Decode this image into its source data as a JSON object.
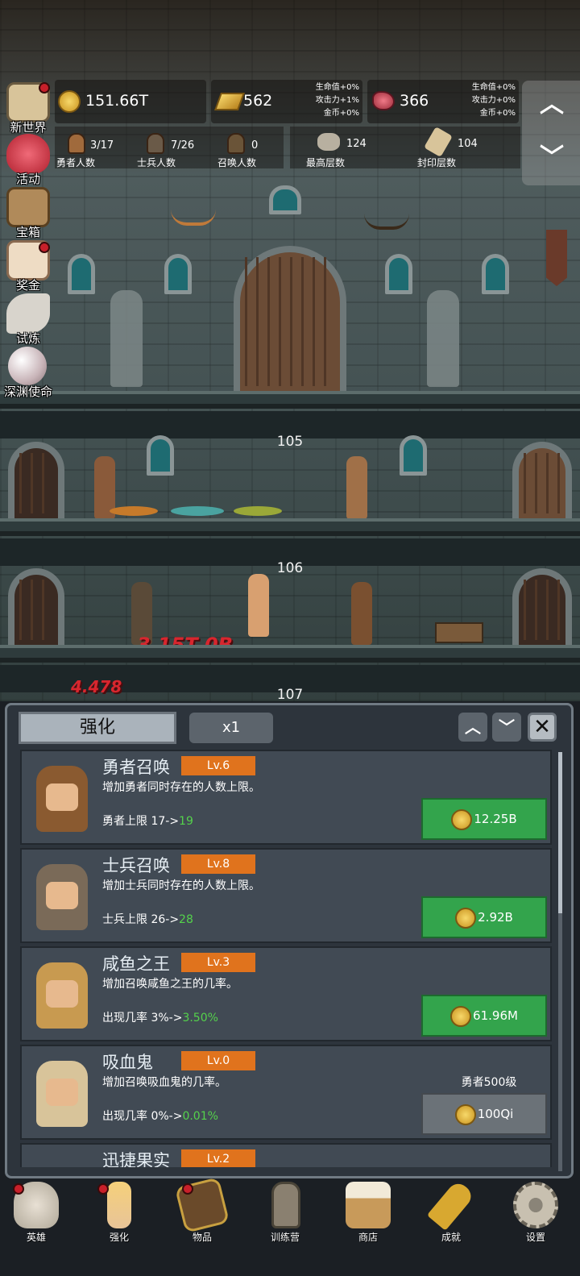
{
  "resources": {
    "coins": "151.66T",
    "gold": "562",
    "gold_bonus": [
      "生命值+0%",
      "攻击力+1%",
      "金币+0%"
    ],
    "gems": "366",
    "gems_bonus": [
      "生命值+0%",
      "攻击力+0%",
      "金币+0%"
    ]
  },
  "stats": [
    {
      "value": "3/17",
      "label": "勇者人数"
    },
    {
      "value": "7/26",
      "label": "士兵人数"
    },
    {
      "value": "0",
      "label": "召唤人数"
    },
    {
      "value": "124",
      "label": "最高层数"
    },
    {
      "value": "104",
      "label": "封印层数"
    }
  ],
  "side_menu": [
    {
      "label": "新世界",
      "icon": "map-icon",
      "dot": true
    },
    {
      "label": "活动",
      "icon": "heart-icon",
      "dot": false
    },
    {
      "label": "宝箱",
      "icon": "chest-icon",
      "dot": false
    },
    {
      "label": "奖金",
      "icon": "envelope-icon",
      "dot": true
    },
    {
      "label": "试炼",
      "icon": "feather-icon",
      "dot": false
    },
    {
      "label": "深渊使命",
      "icon": "pearl-icon",
      "dot": false
    }
  ],
  "scene": {
    "floors": [
      "105",
      "106",
      "107"
    ],
    "damage_1": "3.15T 0B",
    "damage_2": "4.478"
  },
  "panel": {
    "tab_label": "强化",
    "multiplier": "x1",
    "cards": [
      {
        "name": "勇者召唤",
        "level": "Lv.6",
        "desc": "增加勇者同时存在的人数上限。",
        "effect_prefix": "勇者上限 17->",
        "effect_new": "19",
        "cost": "12.25B",
        "locked": false
      },
      {
        "name": "士兵召唤",
        "level": "Lv.8",
        "desc": "增加士兵同时存在的人数上限。",
        "effect_prefix": "士兵上限 26->",
        "effect_new": "28",
        "cost": "2.92B",
        "locked": false
      },
      {
        "name": "咸鱼之王",
        "level": "Lv.3",
        "desc": "增加召唤咸鱼之王的几率。",
        "effect_prefix": "出现几率 3%->",
        "effect_new": "3.50%",
        "cost": "61.96M",
        "locked": false
      },
      {
        "name": "吸血鬼",
        "level": "Lv.0",
        "desc": "增加召唤吸血鬼的几率。",
        "effect_prefix": "出现几率 0%->",
        "effect_new": "0.01%",
        "cost": "100Qi",
        "locked": true,
        "requirement": "勇者500级"
      },
      {
        "name": "迅捷果实",
        "level": "Lv.2"
      }
    ]
  },
  "bottom_nav": [
    {
      "label": "英雄",
      "icon": "skull-icon",
      "dot": true
    },
    {
      "label": "强化",
      "icon": "candle-icon",
      "dot": true
    },
    {
      "label": "物品",
      "icon": "book-icon",
      "dot": true
    },
    {
      "label": "训练营",
      "icon": "lantern-icon",
      "dot": false
    },
    {
      "label": "商店",
      "icon": "beer-mug-icon",
      "dot": false
    },
    {
      "label": "成就",
      "icon": "key-icon",
      "dot": false
    },
    {
      "label": "设置",
      "icon": "gear-icon",
      "dot": false
    }
  ]
}
